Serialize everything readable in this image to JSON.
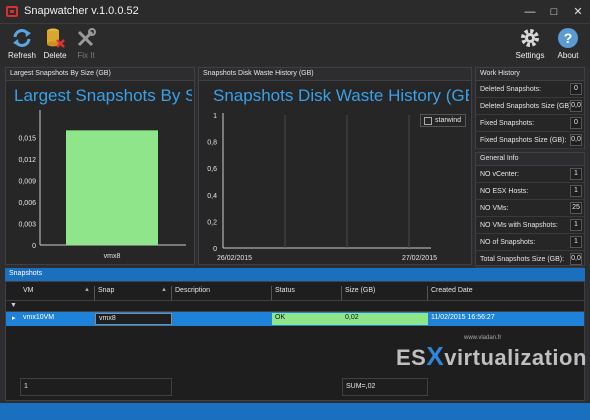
{
  "window": {
    "title": "Snapwatcher v.1.0.0.52",
    "min": "—",
    "max": "□",
    "close": "✕"
  },
  "toolbar": {
    "refresh": "Refresh",
    "delete": "Delete",
    "fix": "Fix It",
    "settings": "Settings",
    "about": "About"
  },
  "icons": {
    "refresh": "refresh-icon",
    "delete": "delete-database-icon",
    "fix": "tools-icon",
    "settings": "gear-icon",
    "about": "help-icon"
  },
  "colors": {
    "accent": "#1e83d8",
    "chart_title": "#3aa0e8",
    "bar": "#8fe58a",
    "status_ok": "#8fe58a"
  },
  "largest": {
    "header": "Largest Snapshots By Size (GB)",
    "title": "Largest Snapshots By S..."
  },
  "waste": {
    "header": "Snapshots Disk Waste History (GB)",
    "title": "Snapshots Disk Waste History (GB)"
  },
  "chart_data": [
    {
      "type": "bar",
      "title": "Largest Snapshots By S...",
      "categories": [
        "vmx8"
      ],
      "values": [
        0.016
      ],
      "ylim": [
        0,
        0.018
      ],
      "yticks": [
        "0",
        "0,003",
        "0,006",
        "0,009",
        "0,012",
        "0,015"
      ],
      "grid": false
    },
    {
      "type": "line",
      "title": "Snapshots Disk Waste History (GB)",
      "xticks": [
        "26/02/2015",
        "27/02/2015"
      ],
      "ylim": [
        0,
        1
      ],
      "yticks": [
        "0",
        "0,2",
        "0,4",
        "0,6",
        "0,8",
        "1"
      ],
      "series": [
        {
          "name": "starwind",
          "values": []
        }
      ],
      "legend": "top-right",
      "grid": true
    }
  ],
  "work_history": {
    "header": "Work History",
    "rows": [
      {
        "label": "Deleted Snapshots:",
        "value": "0"
      },
      {
        "label": "Deleted Snapshots Size (GB):",
        "value": "0,0"
      },
      {
        "label": "Fixed Snapshots:",
        "value": "0"
      },
      {
        "label": "Fixed Snapshots Size (GB):",
        "value": "0,0"
      }
    ]
  },
  "general_info": {
    "header": "General Info",
    "rows": [
      {
        "label": "NO vCenter:",
        "value": "1"
      },
      {
        "label": "NO ESX Hosts:",
        "value": "1"
      },
      {
        "label": "NO VMs:",
        "value": "25"
      },
      {
        "label": "NO VMs with Snapshots:",
        "value": "1"
      },
      {
        "label": "NO of Snapshots:",
        "value": "1"
      },
      {
        "label": "Total Snapshots Size (GB):",
        "value": "0,0"
      }
    ]
  },
  "snapshots": {
    "header": "Snapshots",
    "columns": [
      "VM",
      "Snap",
      "Description",
      "Status",
      "Size (GB)",
      "Created Date"
    ],
    "filter_marker": "▼",
    "row_marker": "▸",
    "rows": [
      {
        "vm": "vmx10VM",
        "snap": "vmx8",
        "description": "",
        "status": "OK",
        "size": "0,02",
        "created": "11/02/2015 16:56:27"
      }
    ],
    "footer": {
      "count": "1",
      "sum": "SUM=,02"
    }
  },
  "watermark": {
    "main_left": "ES",
    "main_x": "X",
    "main_right": "virtualization",
    "sub": "www.vladan.fr"
  }
}
